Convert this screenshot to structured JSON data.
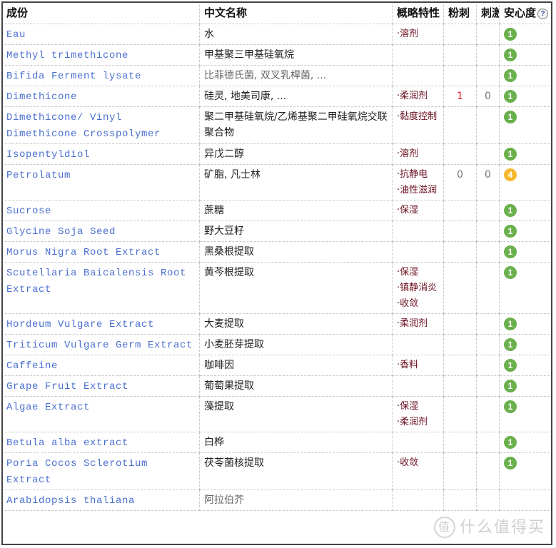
{
  "table": {
    "headers": {
      "ingredient": "成份",
      "chinese_name": "中文名称",
      "features": "概略特性",
      "acne": "粉刺",
      "irritation": "刺激",
      "safety": "安心度"
    },
    "help_icon": "?",
    "colors": {
      "ingredient_link": "#4a6fd0",
      "feature_text": "#6b1021",
      "acne_highlight": "#e0182d",
      "safety_1": "#6ab04c",
      "safety_4": "#f5b82e"
    },
    "rows": [
      {
        "en": "Eau",
        "zh": "水",
        "zh_muted": false,
        "features": [
          "·溶剂"
        ],
        "acne": "",
        "irritation": "",
        "safety": "1"
      },
      {
        "en": "Methyl trimethicone",
        "zh": "甲基聚三甲基硅氧烷",
        "zh_muted": false,
        "features": [],
        "acne": "",
        "irritation": "",
        "safety": "1"
      },
      {
        "en": "Bifida Ferment lysate",
        "zh": "比菲德氏菌, 双叉乳桿菌, ...",
        "zh_muted": true,
        "features": [],
        "acne": "",
        "irritation": "",
        "safety": "1"
      },
      {
        "en": "Dimethicone",
        "zh": "硅灵, 地美司康, ...",
        "zh_muted": false,
        "features": [
          "·柔润剂"
        ],
        "acne": "1",
        "irritation": "0",
        "safety": "1"
      },
      {
        "en": "Dimethicone/ Vinyl Dimethicone Crosspolymer",
        "zh": "聚二甲基硅氧烷/乙烯基聚二甲硅氧烷交联聚合物",
        "zh_muted": false,
        "features": [
          "·黏度控制"
        ],
        "acne": "",
        "irritation": "",
        "safety": "1"
      },
      {
        "en": "Isopentyldiol",
        "zh": "异戊二醇",
        "zh_muted": false,
        "features": [
          "·溶剂"
        ],
        "acne": "",
        "irritation": "",
        "safety": "1"
      },
      {
        "en": "Petrolatum",
        "zh": "矿脂, 凡士林",
        "zh_muted": false,
        "features": [
          "·抗静电",
          "·油性滋润"
        ],
        "acne": "0",
        "irritation": "0",
        "safety": "4"
      },
      {
        "en": "Sucrose",
        "zh": "蔗糖",
        "zh_muted": false,
        "features": [
          "·保湿"
        ],
        "acne": "",
        "irritation": "",
        "safety": "1"
      },
      {
        "en": "Glycine Soja Seed",
        "zh": "野大豆籽",
        "zh_muted": false,
        "features": [],
        "acne": "",
        "irritation": "",
        "safety": "1"
      },
      {
        "en": "Morus Nigra Root Extract",
        "zh": "黑桑根提取",
        "zh_muted": false,
        "features": [],
        "acne": "",
        "irritation": "",
        "safety": "1"
      },
      {
        "en": "Scutellaria Baicalensis Root Extract",
        "zh": "黄芩根提取",
        "zh_muted": false,
        "features": [
          "·保湿",
          "·镇静消炎",
          "·收敛"
        ],
        "acne": "",
        "irritation": "",
        "safety": "1"
      },
      {
        "en": "Hordeum Vulgare Extract",
        "zh": "大麦提取",
        "zh_muted": false,
        "features": [
          "·柔润剂"
        ],
        "acne": "",
        "irritation": "",
        "safety": "1"
      },
      {
        "en": "Triticum Vulgare Germ Extract",
        "zh": "小麦胚芽提取",
        "zh_muted": false,
        "features": [],
        "acne": "",
        "irritation": "",
        "safety": "1"
      },
      {
        "en": "Caffeine",
        "zh": "咖啡因",
        "zh_muted": false,
        "features": [
          "·香料"
        ],
        "acne": "",
        "irritation": "",
        "safety": "1"
      },
      {
        "en": "Grape Fruit Extract",
        "zh": "葡萄果提取",
        "zh_muted": false,
        "features": [],
        "acne": "",
        "irritation": "",
        "safety": "1"
      },
      {
        "en": "Algae Extract",
        "zh": "藻提取",
        "zh_muted": false,
        "features": [
          "·保湿",
          "·柔润剂"
        ],
        "acne": "",
        "irritation": "",
        "safety": "1"
      },
      {
        "en": "Betula alba extract",
        "zh": "白桦",
        "zh_muted": false,
        "features": [],
        "acne": "",
        "irritation": "",
        "safety": "1"
      },
      {
        "en": "Poria Cocos Sclerotium Extract",
        "zh": "茯苓菌核提取",
        "zh_muted": false,
        "features": [
          "·收敛"
        ],
        "acne": "",
        "irritation": "",
        "safety": "1"
      },
      {
        "en": "Arabidopsis thaliana",
        "zh": "阿拉伯芥",
        "zh_muted": true,
        "features": [],
        "acne": "",
        "irritation": "",
        "safety": ""
      }
    ]
  },
  "watermark": {
    "badge": "值",
    "text": "什么值得买"
  }
}
